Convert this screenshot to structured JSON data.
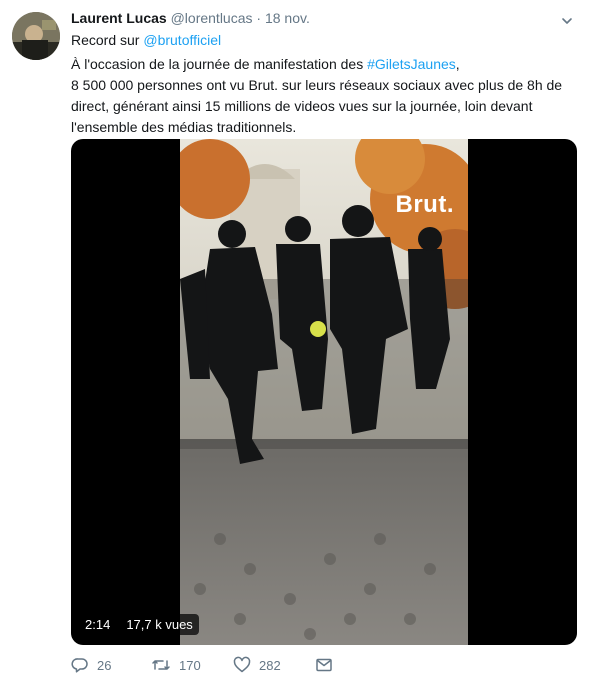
{
  "tweet": {
    "author_name": "Laurent Lucas",
    "author_handle": "@lorentlucas",
    "separator": "·",
    "date": "18 nov.",
    "replying_prefix": "Record sur",
    "replying_mention": "@brutofficiel",
    "text_part1": "À l'occasion de la journée de manifestation des ",
    "hashtag": "#GiletsJaunes",
    "text_part2": ",\n8 500 000 personnes ont vu Brut. sur leurs réseaux sociaux avec plus de 8h de direct, générant ainsi 15 millions de videos vues sur la journée, loin devant l'ensemble des médias traditionnels."
  },
  "media": {
    "watermark": "Brut.",
    "duration": "2:14",
    "views": "17,7 k vues"
  },
  "actions": {
    "reply_count": "26",
    "retweet_count": "170",
    "like_count": "282"
  },
  "icons": [
    "chevron-down-icon",
    "reply-icon",
    "retweet-icon",
    "like-icon",
    "message-icon"
  ],
  "colors": {
    "link": "#1da1f2",
    "secondary": "#657786"
  }
}
